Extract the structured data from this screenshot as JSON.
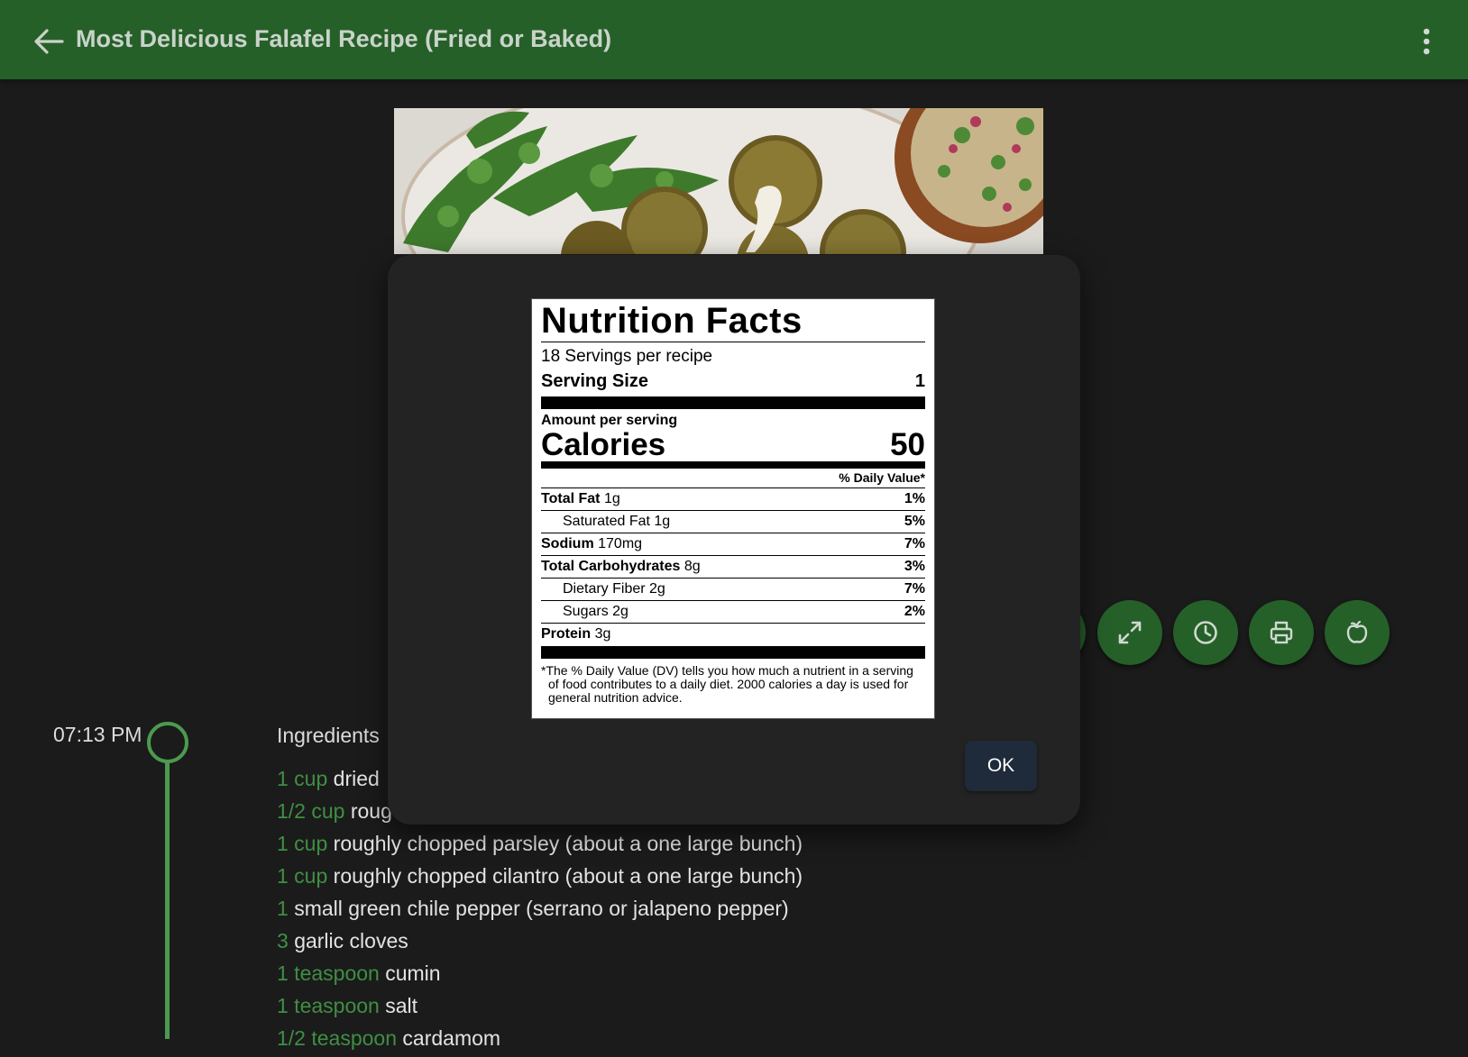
{
  "header": {
    "title": "Most Delicious Falafel Recipe (Fried or Baked)",
    "back_icon": "arrow-left-icon",
    "more_icon": "more-vertical-icon",
    "background": "#256029"
  },
  "hero": {
    "alt": "falafel-photo"
  },
  "actions": [
    {
      "icon": "fullscreen-icon"
    },
    {
      "icon": "clock-icon"
    },
    {
      "icon": "printer-icon"
    },
    {
      "icon": "apple-icon"
    }
  ],
  "timeline": {
    "time": "07:13 PM"
  },
  "ingredients": {
    "title": "Ingredients",
    "items": [
      {
        "qty": "1 cup",
        "text": "dried"
      },
      {
        "qty": "1/2 cup",
        "text": "roug"
      },
      {
        "qty": "1 cup",
        "text": "roughly chopped parsley (about a one large bunch)"
      },
      {
        "qty": "1 cup",
        "text": "roughly chopped cilantro (about a one large bunch)"
      },
      {
        "qty": "1",
        "text": "small green chile pepper (serrano or jalapeno pepper)"
      },
      {
        "qty": "3",
        "text": "garlic cloves"
      },
      {
        "qty": "1 teaspoon",
        "text": "cumin"
      },
      {
        "qty": "1 teaspoon",
        "text": "salt"
      },
      {
        "qty": "1/2 teaspoon",
        "text": "cardamom"
      }
    ]
  },
  "nutrition": {
    "title": "Nutrition Facts",
    "servings": "18 Servings per recipe",
    "serving_size_label": "Serving Size",
    "serving_size_value": "1",
    "amount_label": "Amount per serving",
    "calories_label": "Calories",
    "calories_value": "50",
    "dv_header": "% Daily Value*",
    "rows": [
      {
        "name": "Total Fat",
        "amount": "1g",
        "pct": "1%"
      },
      {
        "name": "Saturated Fat",
        "amount": "1g",
        "pct": "5%"
      },
      {
        "name": "Sodium",
        "amount": "170mg",
        "pct": "7%"
      },
      {
        "name": "Total Carbohydrates",
        "amount": "8g",
        "pct": "3%"
      },
      {
        "name": "Dietary Fiber",
        "amount": "2g",
        "pct": "7%"
      },
      {
        "name": "Sugars",
        "amount": "2g",
        "pct": "2%"
      },
      {
        "name": "Protein",
        "amount": "3g",
        "pct": ""
      }
    ],
    "footnote": "*The % Daily Value (DV) tells you how much a nutrient in a serving of food contributes to a daily diet. 2000 calories a day is used for general nutrition advice."
  },
  "dialog": {
    "ok_label": "OK"
  }
}
